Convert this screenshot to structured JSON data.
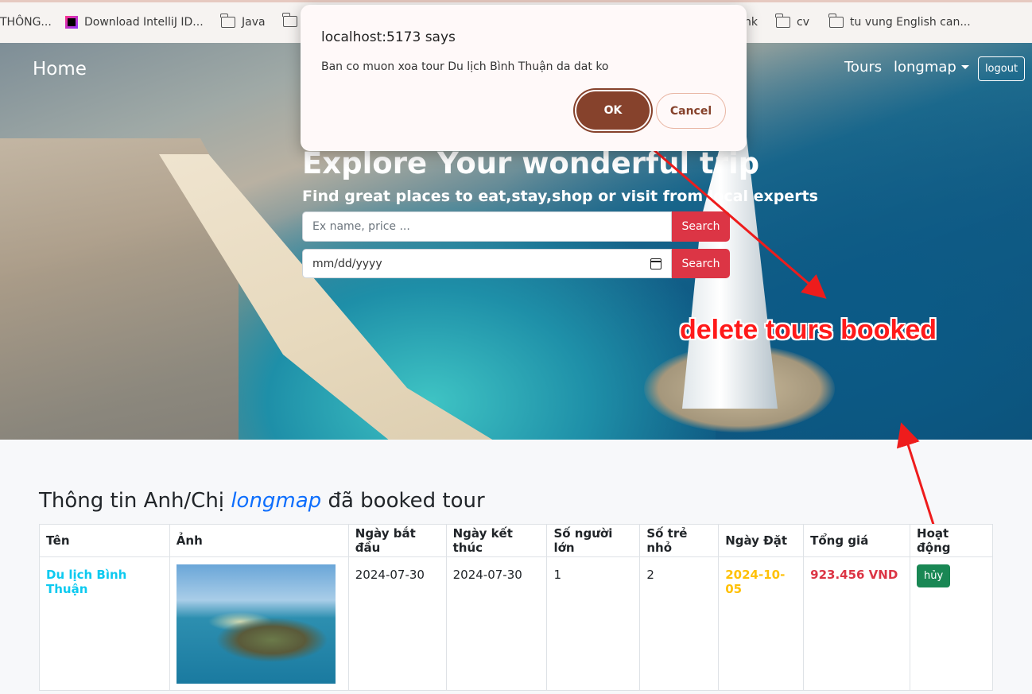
{
  "bookmarks": [
    {
      "label": "THÔNG...",
      "icon": "none"
    },
    {
      "label": "Download IntelliJ ID...",
      "icon": "intellij-icon"
    },
    {
      "label": "Java",
      "icon": "folder-icon"
    },
    {
      "label": "",
      "icon": "folder-icon"
    },
    {
      "label": "nk",
      "icon": "none"
    },
    {
      "label": "cv",
      "icon": "folder-icon"
    },
    {
      "label": "tu vung English can...",
      "icon": "folder-icon"
    }
  ],
  "nav": {
    "home": "Home",
    "tours": "Tours",
    "user": "longmap",
    "logout": "logout"
  },
  "hero": {
    "title": "Explore Your wonderful trip",
    "subtitle": "Find great places to eat,stay,shop or visit from local experts",
    "search_placeholder": "Ex name, price ...",
    "date_placeholder": "mm/dd/yyyy",
    "search_label": "Search",
    "search_date_label": "Search"
  },
  "dialog": {
    "title": "localhost:5173 says",
    "message": "Ban co muon xoa tour Du lịch Bình Thuận da dat ko",
    "ok": "OK",
    "cancel": "Cancel"
  },
  "annotation": {
    "text": "delete tours booked",
    "color": "#ff1a1a"
  },
  "bookings": {
    "title_prefix": "Thông tin Anh/Chị",
    "title_user": "longmap",
    "title_suffix": "đã booked tour",
    "columns": [
      "Tên",
      "Ảnh",
      "Ngày bắt đầu",
      "Ngày kết thúc",
      "Số người lớn",
      "Số trẻ nhỏ",
      "Ngày Đặt",
      "Tổng giá",
      "Hoạt động"
    ],
    "rows": [
      {
        "name": "Du lịch Bình Thuận",
        "start": "2024-07-30",
        "end": "2024-07-30",
        "adults": "1",
        "children": "2",
        "booked_date": "2024-10-05",
        "total": "923.456 VND",
        "action": "hủy"
      }
    ]
  },
  "colors": {
    "search_button": "#dc3545",
    "dialog_ok": "#86422c",
    "cancel_button": "#198754",
    "tour_name": "#0dcaf0",
    "booked_date": "#ffc107",
    "total": "#dc3545"
  }
}
